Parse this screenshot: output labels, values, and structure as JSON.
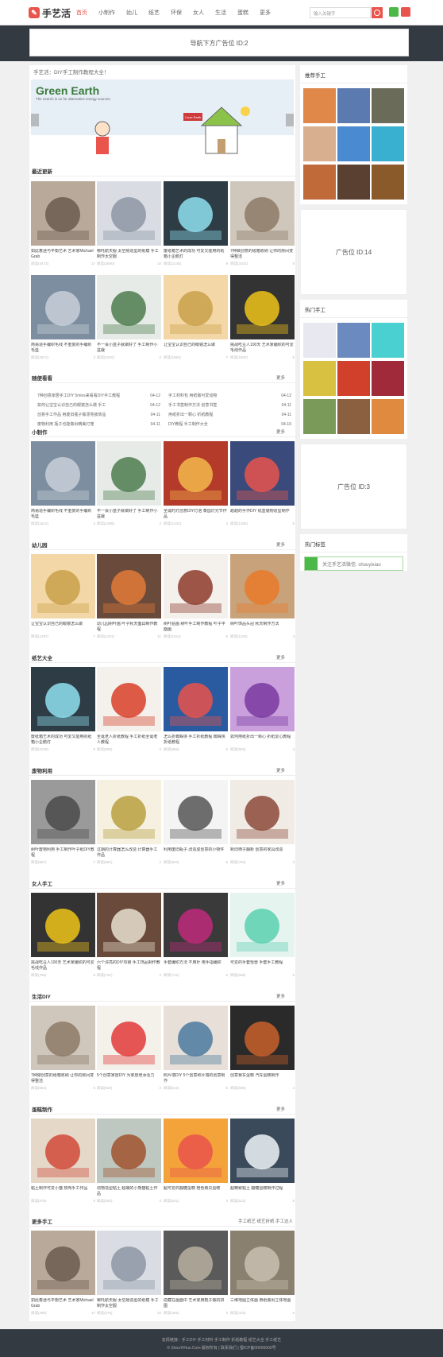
{
  "header": {
    "logo_text": "手艺活",
    "nav": [
      "首页",
      "小制作",
      "幼儿",
      "纸艺",
      "环保",
      "女人",
      "生活",
      "蛋糕",
      "更多"
    ],
    "search_placeholder": "输入关键字"
  },
  "top_ad": "导航下方广告位 ID:2",
  "crumb": "手艺活：DIY手工制作教程大全！",
  "slide": {
    "title": "Green Earth",
    "subtitle": "The search is on for alternative energy sources",
    "sign": "I love Earth"
  },
  "sections": [
    {
      "title": "最近更新",
      "more": ""
    },
    {
      "title": "随便看看",
      "more": "更多"
    },
    {
      "title": "小制作",
      "more": "更多"
    },
    {
      "title": "幼儿园",
      "more": "更多"
    },
    {
      "title": "纸艺大全",
      "more": "更多"
    },
    {
      "title": "废物利用",
      "more": "更多"
    },
    {
      "title": "女人手工",
      "more": "更多"
    },
    {
      "title": "生活DIY",
      "more": "更多"
    },
    {
      "title": "蛋糕制作",
      "more": "更多"
    },
    {
      "title": "更多手工",
      "more": "手工纸艺 纸艺折纸 手工达人"
    }
  ],
  "cards": [
    {
      "t": "如此着迷与平衡艺术 艺术家Michael Grab",
      "m": "阅读(4473)",
      "c": "17"
    },
    {
      "t": "哪吒航天服 太空舱造型的纸模 手工制作太空服",
      "m": "阅读(3890)",
      "c": "10"
    },
    {
      "t": "废纸箱艺术的成功 可爱又能用的纸箱小企鹅灯",
      "m": "阅读(2145)",
      "c": "9"
    },
    {
      "t": "7种做创意的纸箱收纳 让你的房间变得整洁",
      "m": "阅读(3102)",
      "c": "9"
    },
    {
      "t": "简易造手编织毛线 不重复的手编织毛篮",
      "m": "阅读(2871)",
      "c": "3"
    },
    {
      "t": "不一会小盒子就做好了 手工制作小盆栽",
      "m": "阅读(2310)",
      "c": "2"
    },
    {
      "t": "让宝宝认识自己的眼镜怎么做",
      "m": "阅读(1954)",
      "c": "7"
    },
    {
      "t": "挑战吃豆人100天 艺术家编织的可爱毛线作品",
      "m": "阅读(1802)",
      "c": "8"
    },
    {
      "t": "简易造手编织毛线 不重复的手编织毛篮",
      "m": "阅读(1612)",
      "c": "3"
    },
    {
      "t": "不一会小盒子就做好了 手工制作小盆栽",
      "m": "阅读(1499)",
      "c": "2"
    },
    {
      "t": "圣诞时灯创意DIY灯泡 泰国灯光节作品",
      "m": "阅读(1432)",
      "c": "4"
    },
    {
      "t": "甜甜的手作DIY 纸盒储物造型制作",
      "m": "阅读(1385)",
      "c": "5"
    },
    {
      "t": "让宝宝认识自己的眼镜怎么做",
      "m": "阅读(1287)",
      "c": "7"
    },
    {
      "t": "幼儿园树叶画 叶子秋天面具制作教程",
      "m": "阅读(1201)",
      "c": "11"
    },
    {
      "t": "树叶贴画 树叶手工制作教程 叶子平面画",
      "m": "阅读(1154)",
      "c": "6"
    },
    {
      "t": "树叶饰品头冠 秋天制作方法",
      "m": "阅读(1102)",
      "c": "4"
    },
    {
      "t": "废纸箱艺术的成功 可爱又能用的纸箱小企鹅灯",
      "m": "阅读(1045)",
      "c": "9"
    },
    {
      "t": "圣诞老人折纸教程 手工折纸圣诞老人教程",
      "m": "阅读(998)",
      "c": "3"
    },
    {
      "t": "怎么折蜘蛛侠 手工折纸教程 蜘蛛侠折纸教程",
      "m": "阅读(956)",
      "c": "5"
    },
    {
      "t": "如何用纸折出一颗心 折纸爱心教程",
      "m": "阅读(903)",
      "c": "4"
    },
    {
      "t": "树叶废物利用 手工制作叶子纸DIY教程",
      "m": "阅读(887)",
      "c": "7"
    },
    {
      "t": "过期的计算器怎么改造 计算器手工作品",
      "m": "阅读(851)",
      "c": "2"
    },
    {
      "t": "利用废旧瓶子 改造成创意的小物件",
      "m": "阅读(820)",
      "c": "5"
    },
    {
      "t": "新旧椅子翻新 创意的家具改造",
      "m": "阅读(793)",
      "c": "3"
    },
    {
      "t": "挑战吃豆人100天 艺术家编织的可爱毛线作品",
      "m": "阅读(766)",
      "c": "8"
    },
    {
      "t": "六个漂亮的DIY项链 手工饰品制作教程",
      "m": "阅读(741)",
      "c": "4"
    },
    {
      "t": "手套编织方法 不用针 用手指编织",
      "m": "阅读(712)",
      "c": "6"
    },
    {
      "t": "可爱的手套怪兽 手套手工教程",
      "m": "阅读(688)",
      "c": "5"
    },
    {
      "t": "7种做创意的纸箱收纳 让你的房间变得整洁",
      "m": "阅读(654)",
      "c": "9"
    },
    {
      "t": "5个创意家居DIY 为家居增添活力",
      "m": "阅读(630)",
      "c": "3"
    },
    {
      "t": "照片墙DIY 5个创意照片墙的创意制作",
      "m": "阅读(612)",
      "c": "5"
    },
    {
      "t": "创意赛车蛋糕 汽车蛋糕制作",
      "m": "阅读(598)",
      "c": "4"
    },
    {
      "t": "粘土制作可爱小猫 软陶手工作品",
      "m": "阅读(575)",
      "c": "6"
    },
    {
      "t": "动物造型粘土 超萌的小熊猫粘土作品",
      "m": "阅读(553)",
      "c": "3"
    },
    {
      "t": "超可爱的翻糖蛋糕 橙色南瓜蛋糕",
      "m": "阅读(531)",
      "c": "4"
    },
    {
      "t": "超精致粘土 翻糖蛋糕制作过程",
      "m": "阅读(512)",
      "c": "5"
    },
    {
      "t": "如此着迷与平衡艺术 艺术家Michael Grab",
      "m": "阅读(498)",
      "c": "17"
    },
    {
      "t": "哪吒航天服 太空舱造型的纸模 手工制作太空服",
      "m": "阅读(476)",
      "c": "10"
    },
    {
      "t": "隐藏在画面中 艺术家用鞋子做的拼图",
      "m": "阅读(455)",
      "c": "3"
    },
    {
      "t": "三维地图立体画 用纸做出立体地图",
      "m": "阅读(433)",
      "c": "5"
    }
  ],
  "news": [
    [
      "7种创意家居手工DIY 5mins来看看DIY手工教程",
      "04-12",
      "手工材料包 用纸做可爱动物",
      "04-12"
    ],
    [
      "如何让宝宝认识自己的眼镜怎么做 手工",
      "04-12",
      "手工书签制作方法 创意书签",
      "04-11"
    ],
    [
      "创意手工作品 用废旧瓶子做漂亮装饰品",
      "04-11",
      "用纸折出一颗心 折纸教程",
      "04-11"
    ],
    [
      "废物利用 瓶子也能做出精美灯笼",
      "04-11",
      "DIY教程 手工制作大全",
      "04-10"
    ]
  ],
  "sidebar": {
    "rec_title": "推荐手工",
    "ad1": "广告位 ID:14",
    "hot_title": "热门手工",
    "ad2": "广告位 ID:3",
    "tag_title": "热门标签",
    "wx": "关注手艺活微信: shouyixiao"
  },
  "footer": {
    "line1": "友情链接：手工DIY 手工材料 手工制作 折纸教程 纸艺大全 手工纸艺",
    "line2": "© ShouYiHuo.Com 版权所有 | 联系我们 | 蜀ICP备00000000号"
  },
  "colors": {
    "accent": "#e9544c",
    "band": "#333a42"
  }
}
